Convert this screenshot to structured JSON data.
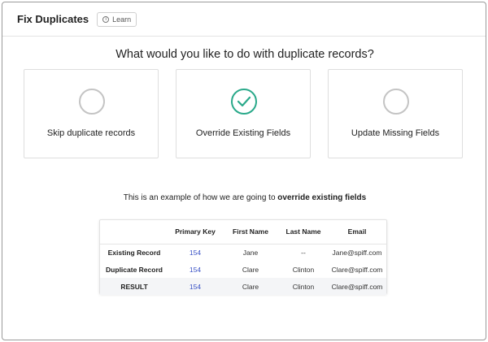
{
  "header": {
    "title": "Fix Duplicates",
    "learn_label": "Learn",
    "learn_icon": "info-icon"
  },
  "question": "What would you like to do with duplicate records?",
  "options": [
    {
      "label": "Skip duplicate records",
      "selected": false
    },
    {
      "label": "Override Existing Fields",
      "selected": true
    },
    {
      "label": "Update Missing Fields",
      "selected": false
    }
  ],
  "example": {
    "prefix": "This is an example of how we are going to ",
    "emphasis": "override existing fields"
  },
  "table": {
    "headers": [
      "",
      "Primary Key",
      "First Name",
      "Last Name",
      "Email"
    ],
    "rows": [
      [
        "Existing Record",
        "154",
        "Jane",
        "--",
        "Jane@spiff.com"
      ],
      [
        "Duplicate Record",
        "154",
        "Clare",
        "Clinton",
        "Clare@spiff.com"
      ],
      [
        "RESULT",
        "154",
        "Clare",
        "Clinton",
        "Clare@spiff.com"
      ]
    ]
  },
  "colors": {
    "accent": "#2aa98a",
    "link": "#3a52c6",
    "border": "#dedede"
  }
}
